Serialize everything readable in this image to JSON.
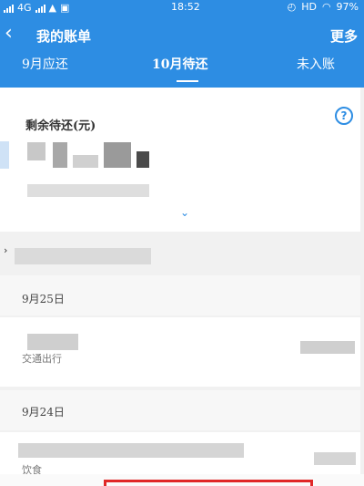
{
  "status_bar": {
    "network": "4G",
    "time": "18:52",
    "hd": "HD",
    "battery": "97%"
  },
  "header": {
    "title": "我的账单",
    "more_label": "更多"
  },
  "tabs": [
    {
      "label": "9月应还"
    },
    {
      "label": "10月待还"
    },
    {
      "label": "未入账"
    }
  ],
  "summary": {
    "remaining_label": "剩余待还(元)",
    "help_icon": "?"
  },
  "transactions": [
    {
      "date": "9月25日",
      "name": "交通出行"
    },
    {
      "date": "9月24日",
      "name": "饮食"
    }
  ]
}
